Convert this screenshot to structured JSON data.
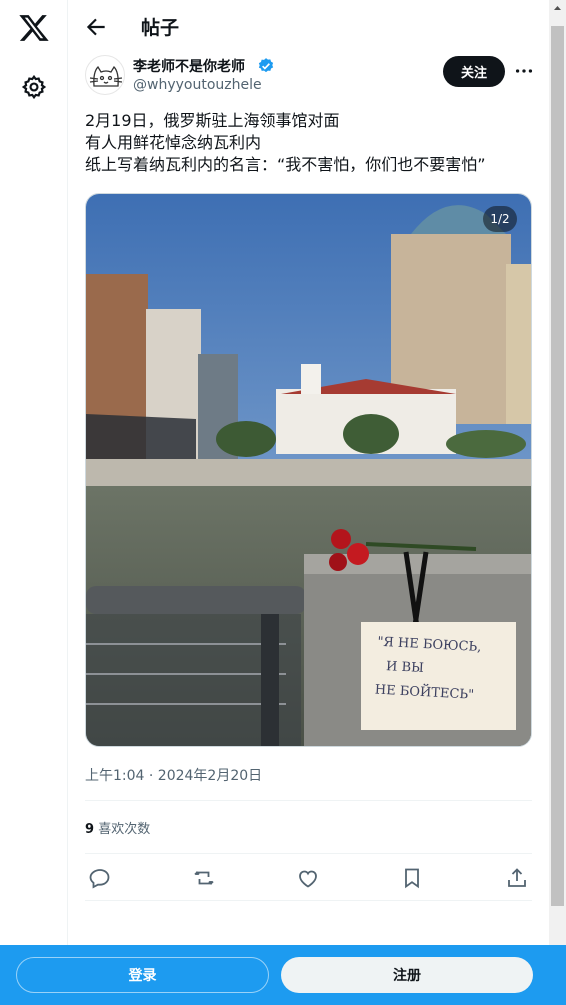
{
  "header": {
    "title": "帖子",
    "back_icon": "arrow-left-icon"
  },
  "sidebar": {
    "logo_icon": "x-logo-icon",
    "settings_icon": "gear-icon"
  },
  "post": {
    "display_name": "李老师不是你老师",
    "handle": "@whyyoutouzhele",
    "verified": true,
    "follow_label": "关注",
    "text_lines": [
      "2月19日，俄罗斯驻上海领事馆对面",
      "有人用鲜花悼念纳瓦利内",
      "纸上写着纳瓦利内的名言：“我不害怕，你们也不要害怕”"
    ],
    "media": {
      "counter": "1/2",
      "sign_lines": [
        "\"Я НЕ БОЮСЬ,",
        "И ВЫ",
        "НЕ БОЙТЕСЬ\""
      ]
    },
    "timestamp": "上午1:04 · 2024年2月20日",
    "likes_count": "9",
    "likes_label": "喜欢次数"
  },
  "actions": [
    "reply-icon",
    "retweet-icon",
    "like-icon",
    "bookmark-icon",
    "share-icon"
  ],
  "auth": {
    "login_label": "登录",
    "signup_label": "注册"
  },
  "colors": {
    "brand": "#1d9bf0",
    "text": "#0f1419",
    "muted": "#536471"
  }
}
